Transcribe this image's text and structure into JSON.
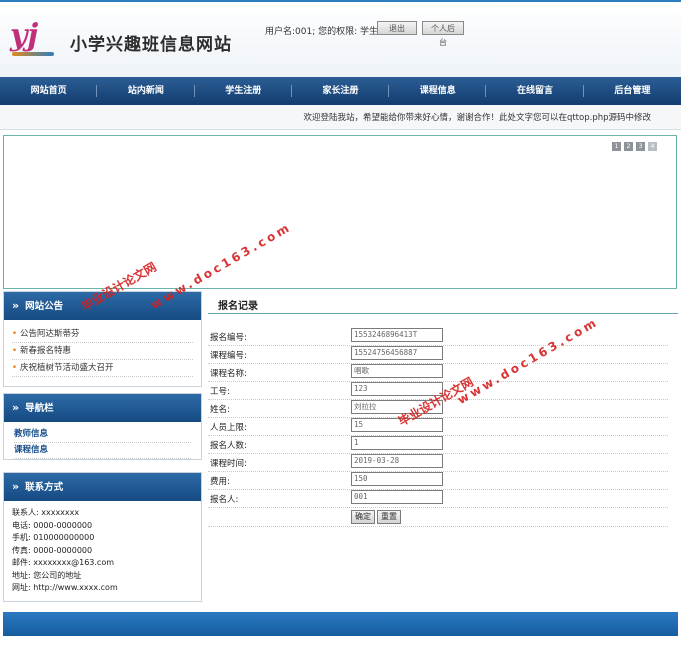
{
  "header": {
    "logo_text": "yj",
    "site_title": "小学兴趣班信息网站",
    "user_info": "用户名:001; 您的权限: 学生",
    "logout_label": "退出",
    "backend_label": "个人后台"
  },
  "nav": {
    "items": [
      "网站首页",
      "站内新闻",
      "学生注册",
      "家长注册",
      "课程信息",
      "在线留言",
      "后台管理"
    ]
  },
  "marquee": {
    "text": "欢迎登陆我站，希望能给你带来好心情，谢谢合作！此处文字您可以在qttop.php源码中修改"
  },
  "banner": {
    "controls": [
      "1",
      "2",
      "3",
      "4"
    ]
  },
  "sidebar": {
    "notice": {
      "title": "网站公告",
      "items": [
        "公告阿达斯蒂芬",
        "新春报名特惠",
        "庆祝植树节活动盛大召开"
      ]
    },
    "navbar": {
      "title": "导航栏",
      "items": [
        "教师信息",
        "课程信息"
      ]
    },
    "contact": {
      "title": "联系方式",
      "rows": [
        "联系人: xxxxxxxx",
        "电话: 0000-0000000",
        "手机: 010000000000",
        "传真: 0000-0000000",
        "邮件: xxxxxxxx@163.com",
        "地址: 您公司的地址",
        "网址: http://www.xxxx.com"
      ]
    }
  },
  "main": {
    "title": "报名记录",
    "fields": [
      {
        "label": "报名编号:",
        "value": "1553246896413T"
      },
      {
        "label": "课程编号:",
        "value": "15524756456887"
      },
      {
        "label": "课程名称:",
        "value": "唱歌"
      },
      {
        "label": "工号:",
        "value": "123"
      },
      {
        "label": "姓名:",
        "value": "刘拉拉"
      },
      {
        "label": "人员上限:",
        "value": "15"
      },
      {
        "label": "报名人数:",
        "value": "1"
      },
      {
        "label": "课程时间:",
        "value": "2019-03-28"
      },
      {
        "label": "费用:",
        "value": "150"
      },
      {
        "label": "报名人:",
        "value": "001"
      }
    ],
    "confirm_label": "确定",
    "reset_label": "重置"
  },
  "watermark": {
    "line1": "毕业设计论文网",
    "line2": "www.doc163.com"
  },
  "colors": {
    "nav_bg": "#1c4a7e",
    "accent": "#2d7fc0",
    "footer_bg": "#1f6db4",
    "watermark": "#d51f1f"
  }
}
